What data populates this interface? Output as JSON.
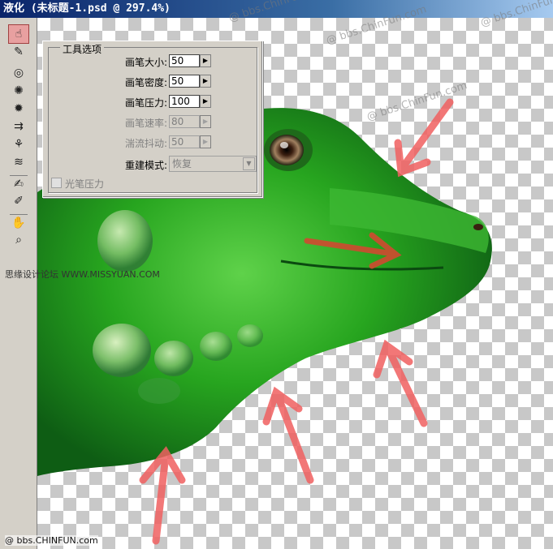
{
  "window": {
    "title": "液化 (未标题-1.psd @ 297.4%)"
  },
  "tools": [
    {
      "name": "warp-tool-icon",
      "glyph": "☝"
    },
    {
      "name": "reconstruct-tool-icon",
      "glyph": "✎"
    },
    {
      "name": "twirl-clockwise-tool-icon",
      "glyph": "◎"
    },
    {
      "name": "pucker-tool-icon",
      "glyph": "✺"
    },
    {
      "name": "bloat-tool-icon",
      "glyph": "✹"
    },
    {
      "name": "push-left-tool-icon",
      "glyph": "⇉"
    },
    {
      "name": "mirror-tool-icon",
      "glyph": "⚘"
    },
    {
      "name": "turbulence-tool-icon",
      "glyph": "≋"
    },
    {
      "name": "freeze-mask-tool-icon",
      "glyph": "✍"
    },
    {
      "name": "thaw-mask-tool-icon",
      "glyph": "✐"
    },
    {
      "name": "hand-tool-icon",
      "glyph": "✋"
    },
    {
      "name": "zoom-tool-icon",
      "glyph": "🔍"
    }
  ],
  "tool_options": {
    "legend": "工具选项",
    "brush_size": {
      "label": "画笔大小:",
      "value": "50"
    },
    "brush_density": {
      "label": "画笔密度:",
      "value": "50"
    },
    "brush_pressure": {
      "label": "画笔压力:",
      "value": "100"
    },
    "brush_rate": {
      "label": "画笔速率:",
      "value": "80"
    },
    "turbulent_jitter": {
      "label": "湍流抖动:",
      "value": "50"
    },
    "reconstruct_mode": {
      "label": "重建模式:",
      "value": "恢复"
    },
    "stylus_pressure": {
      "label": "光笔压力"
    }
  },
  "watermarks": {
    "site": "@ bbs.ChinFun.com",
    "left": "思缘设计论坛 WWW.MISSYUAN.COM",
    "bottom": "@ bbs.CHINFUN.com"
  },
  "colors": {
    "accent_arrow": "#f06060",
    "lizard_green": "#22a020"
  }
}
